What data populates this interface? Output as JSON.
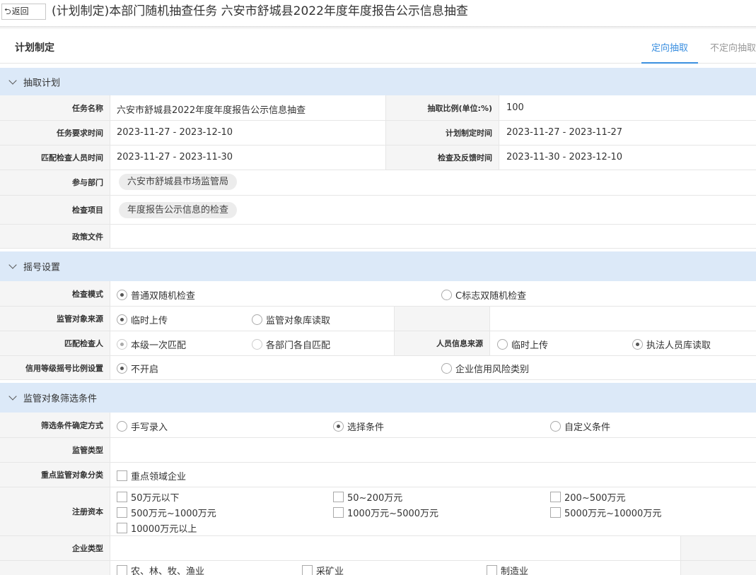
{
  "header": {
    "back_label": "返回",
    "title": "(计划制定)本部门随机抽查任务 六安市舒城县2022年度年度报告公示信息抽查"
  },
  "plan": {
    "title": "计划制定",
    "tabs": [
      {
        "label": "定向抽取",
        "active": true
      },
      {
        "label": "不定向抽取",
        "active": false
      }
    ]
  },
  "extract_plan": {
    "section_title": "抽取计划",
    "task_name_label": "任务名称",
    "task_name": "六安市舒城县2022年度年度报告公示信息抽查",
    "ratio_label": "抽取比例(单位:%)",
    "ratio": "100",
    "req_time_label": "任务要求时间",
    "req_time": "2023-11-27 - 2023-12-10",
    "plan_time_label": "计划制定时间",
    "plan_time": "2023-11-27 - 2023-11-27",
    "match_time_label": "匹配检查人员时间",
    "match_time": "2023-11-27 - 2023-11-30",
    "check_time_label": "检查及反馈时间",
    "check_time": "2023-11-30 - 2023-12-10",
    "dept_label": "参与部门",
    "dept": "六安市舒城县市场监管局",
    "item_label": "检查项目",
    "item": "年度报告公示信息的检查",
    "policy_label": "政策文件"
  },
  "lottery": {
    "section_title": "摇号设置",
    "mode_label": "检查模式",
    "mode_opt1": "普通双随机检查",
    "mode_opt2": "C标志双随机检查",
    "source_label": "监管对象来源",
    "source_opt1": "临时上传",
    "source_opt2": "监管对象库读取",
    "match_label": "匹配检查人",
    "match_opt1": "本级一次匹配",
    "match_opt2": "各部门各自匹配",
    "person_label": "人员信息来源",
    "person_opt1": "临时上传",
    "person_opt2": "执法人员库读取",
    "credit_label": "信用等级摇号比例设置",
    "credit_opt1": "不开启",
    "credit_opt2": "企业信用风险类别"
  },
  "filter": {
    "section_title": "监管对象筛选条件",
    "method_label": "筛选条件确定方式",
    "method_opt1": "手写录入",
    "method_opt2": "选择条件",
    "method_opt3": "自定义条件",
    "type_label": "监管类型",
    "key_label": "重点监管对象分类",
    "key_opt1": "重点领域企业",
    "capital_label": "注册资本",
    "capital": [
      "50万元以下",
      "50~200万元",
      "200~500万元",
      "500万元~1000万元",
      "1000万元~5000万元",
      "5000万元~10000万元",
      "10000万元以上"
    ],
    "ent_type_label": "企业类型",
    "industry": [
      "农、林、牧、渔业",
      "采矿业",
      "制造业"
    ]
  }
}
